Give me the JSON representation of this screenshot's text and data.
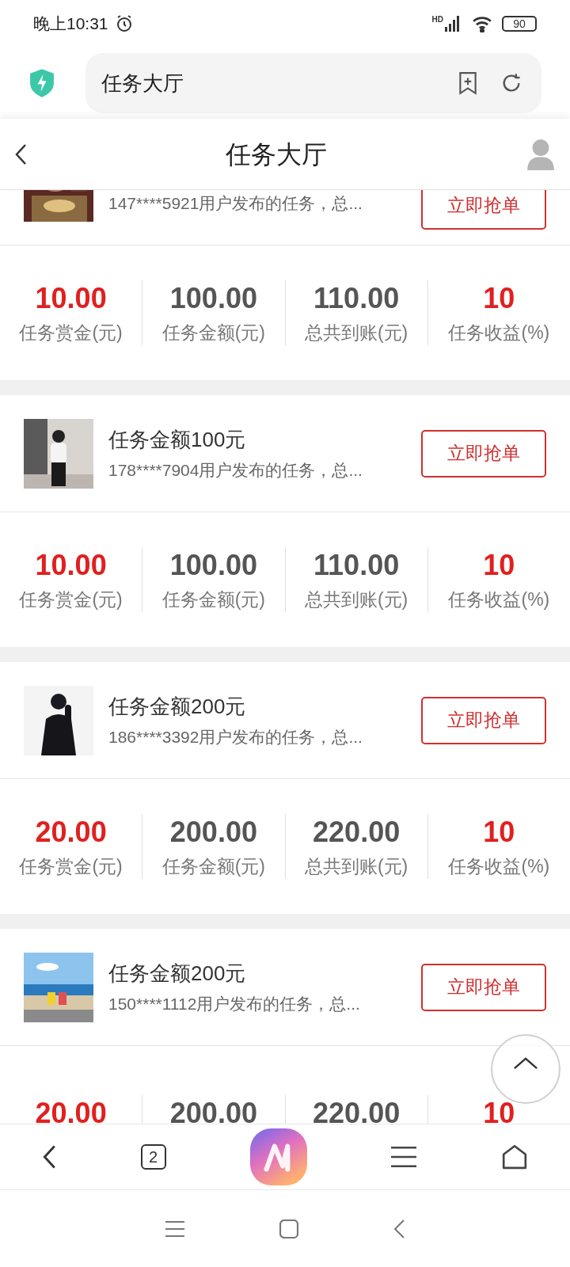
{
  "status_bar": {
    "time": "晚上10:31",
    "signal_label": "HD",
    "battery": "90"
  },
  "address_bar": {
    "value": "任务大厅"
  },
  "header": {
    "title": "任务大厅"
  },
  "cards": [
    {
      "subtitle": "147****5921用户发布的任务，总...",
      "button": "立即抢单",
      "stats": [
        {
          "value": "10.00",
          "label": "任务赏金(元)",
          "color": "#e02020"
        },
        {
          "value": "100.00",
          "label": "任务金额(元)",
          "color": "#555555"
        },
        {
          "value": "110.00",
          "label": "总共到账(元)",
          "color": "#555555"
        },
        {
          "value": "10",
          "label": "任务收益(%)",
          "color": "#e02020"
        }
      ]
    },
    {
      "title": "任务金额100元",
      "subtitle": "178****7904用户发布的任务，总...",
      "button": "立即抢单",
      "stats": [
        {
          "value": "10.00",
          "label": "任务赏金(元)",
          "color": "#e02020"
        },
        {
          "value": "100.00",
          "label": "任务金额(元)",
          "color": "#555555"
        },
        {
          "value": "110.00",
          "label": "总共到账(元)",
          "color": "#555555"
        },
        {
          "value": "10",
          "label": "任务收益(%)",
          "color": "#e02020"
        }
      ]
    },
    {
      "title": "任务金额200元",
      "subtitle": "186****3392用户发布的任务，总...",
      "button": "立即抢单",
      "stats": [
        {
          "value": "20.00",
          "label": "任务赏金(元)",
          "color": "#e02020"
        },
        {
          "value": "200.00",
          "label": "任务金额(元)",
          "color": "#555555"
        },
        {
          "value": "220.00",
          "label": "总共到账(元)",
          "color": "#555555"
        },
        {
          "value": "10",
          "label": "任务收益(%)",
          "color": "#e02020"
        }
      ]
    },
    {
      "title": "任务金额200元",
      "subtitle": "150****1112用户发布的任务，总...",
      "button": "立即抢单",
      "stats": [
        {
          "value": "20.00",
          "color": "#e02020"
        },
        {
          "value": "200.00",
          "color": "#555555"
        },
        {
          "value": "220.00",
          "color": "#555555"
        },
        {
          "value": "10",
          "color": "#e02020"
        }
      ]
    }
  ],
  "bottom_nav": {
    "tab_count": "2"
  }
}
